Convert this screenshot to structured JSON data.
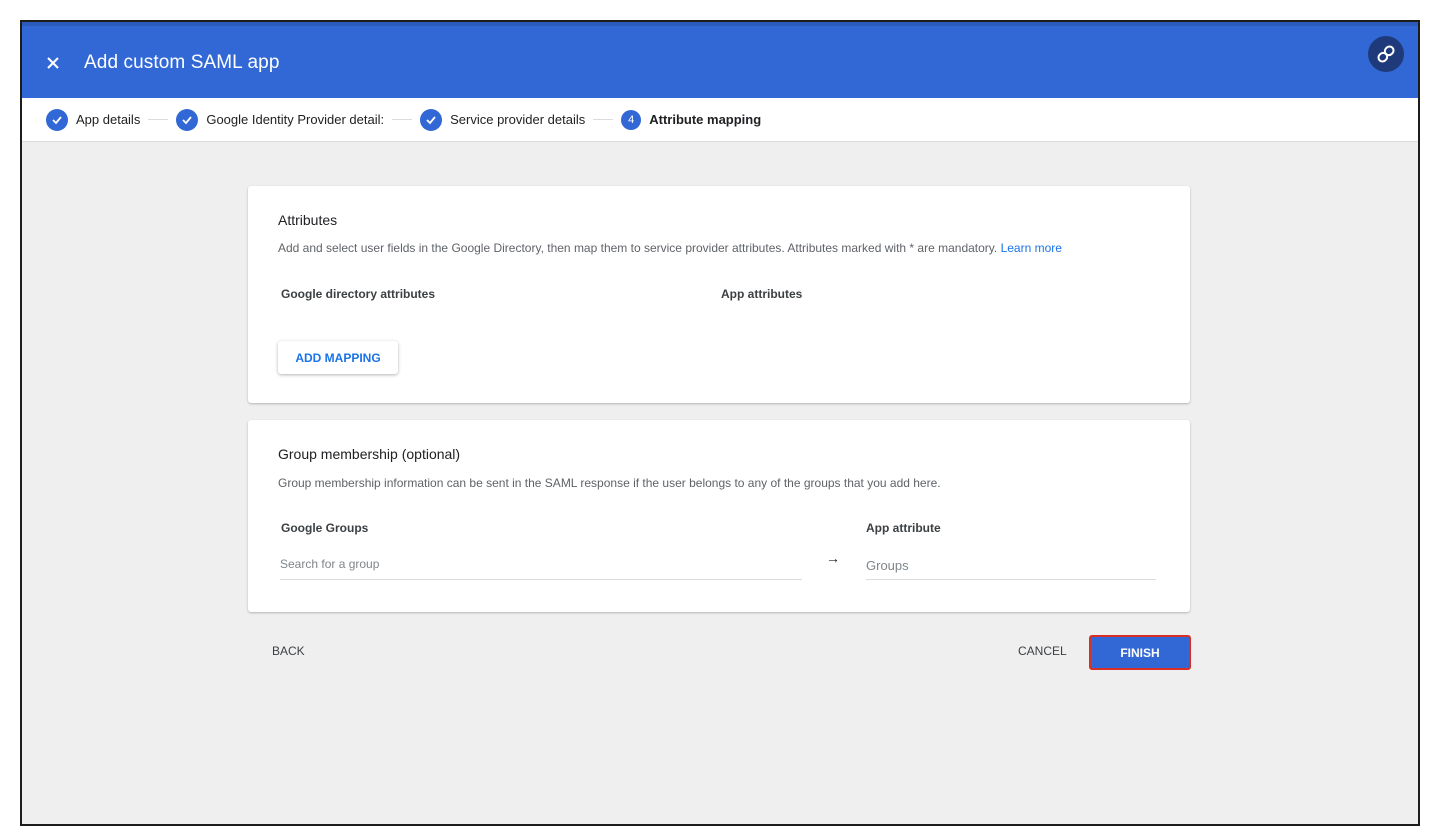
{
  "header": {
    "title": "Add custom SAML app",
    "close_icon": "close-icon",
    "link_icon": "link-icon",
    "accent_color": "#3268d6"
  },
  "stepper": {
    "steps": [
      {
        "label": "App details",
        "state": "done"
      },
      {
        "label": "Google Identity Provider detail:",
        "state": "done"
      },
      {
        "label": "Service provider details",
        "state": "done"
      },
      {
        "label": "Attribute mapping",
        "state": "active",
        "number": "4"
      }
    ]
  },
  "attributes_card": {
    "title": "Attributes",
    "description": "Add and select user fields in the Google Directory, then map them to service provider attributes. Attributes marked with * are mandatory.",
    "learn_more": "Learn more",
    "col_directory": "Google directory attributes",
    "col_app": "App attributes",
    "add_mapping_label": "ADD MAPPING"
  },
  "group_card": {
    "title": "Group membership (optional)",
    "description": "Group membership information can be sent in the SAML response if the user belongs to any of the groups that you add here.",
    "col_groups": "Google Groups",
    "search_placeholder": "Search for a group",
    "arrow": "→",
    "col_app_attribute": "App attribute",
    "app_attribute_value": "Groups"
  },
  "footer": {
    "back_label": "BACK",
    "cancel_label": "CANCEL",
    "finish_label": "FINISH",
    "finish_border_color": "#d93025"
  }
}
